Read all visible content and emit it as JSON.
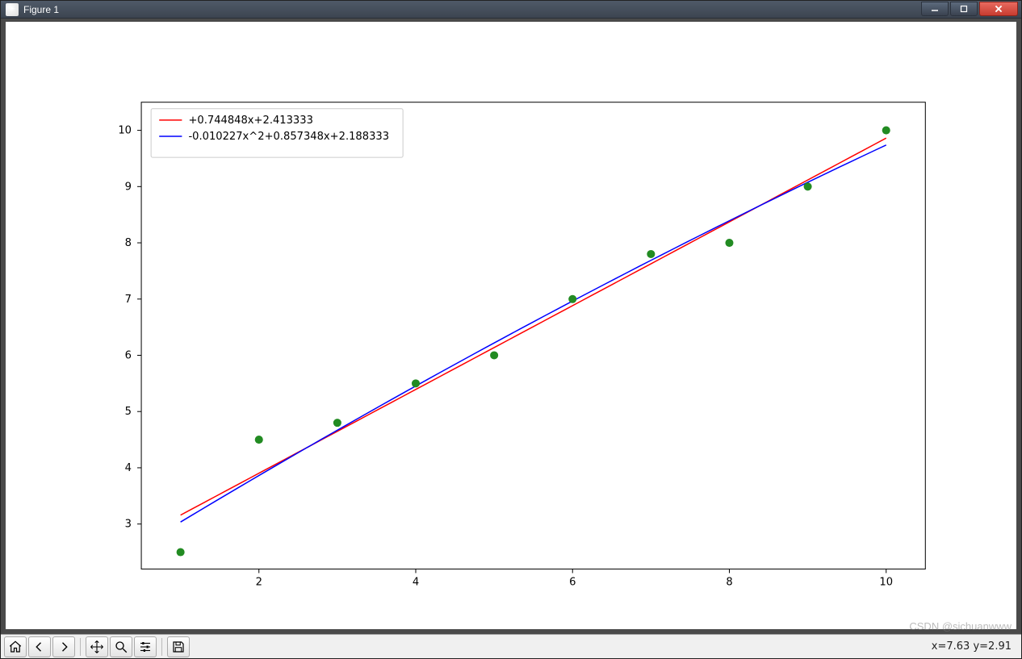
{
  "window": {
    "title": "Figure 1"
  },
  "status": {
    "coords": "x=7.63 y=2.91"
  },
  "watermark": "CSDN @sichuanwww",
  "chart_data": {
    "type": "scatter",
    "title": "",
    "xlabel": "",
    "ylabel": "",
    "xlim": [
      0.5,
      10.5
    ],
    "ylim": [
      2.2,
      10.5
    ],
    "xticks": [
      2,
      4,
      6,
      8,
      10
    ],
    "yticks": [
      3,
      4,
      5,
      6,
      7,
      8,
      9,
      10
    ],
    "points": {
      "x": [
        1,
        2,
        3,
        4,
        5,
        6,
        7,
        8,
        9,
        10
      ],
      "y": [
        2.5,
        4.5,
        4.8,
        5.5,
        6.0,
        7.0,
        7.8,
        8.0,
        9.0,
        10.0
      ]
    },
    "series": [
      {
        "name": "+0.744848x+2.413333",
        "color": "#ff0000",
        "type": "line",
        "formula": {
          "kind": "poly1",
          "a": 0.744848,
          "b": 2.413333
        }
      },
      {
        "name": "-0.010227x^2+0.857348x+2.188333",
        "color": "#0000ff",
        "type": "line",
        "formula": {
          "kind": "poly2",
          "a": -0.010227,
          "b": 0.857348,
          "c": 2.188333
        }
      }
    ],
    "legend": {
      "position": "upper left",
      "entries": [
        "+0.744848x+2.413333",
        "-0.010227x^2+0.857348x+2.188333"
      ]
    }
  }
}
